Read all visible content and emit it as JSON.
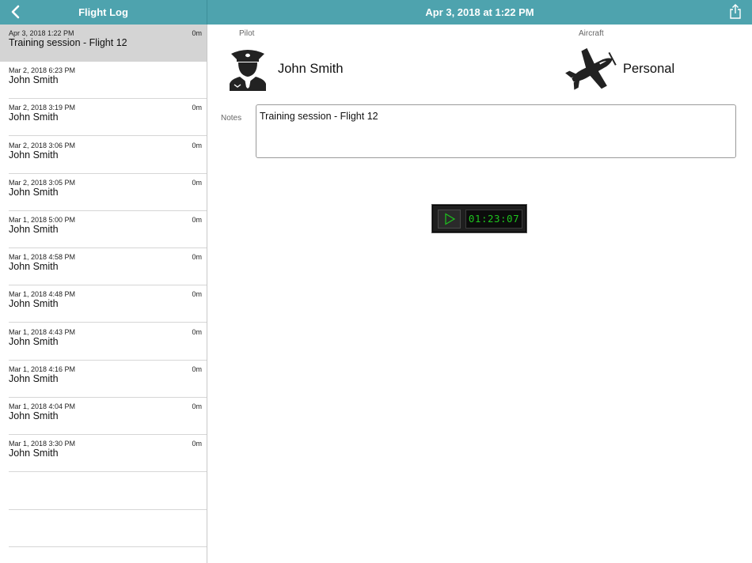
{
  "navbar": {
    "left_title": "Flight Log",
    "right_title": "Apr 3, 2018 at 1:22 PM",
    "back_icon": "chevron-left-icon",
    "share_icon": "share-icon"
  },
  "colors": {
    "navbar_bg": "#4ea3ae",
    "selected_row_bg": "#d4d4d4",
    "timer_digits": "#1ec31e"
  },
  "flights": [
    {
      "date": "Apr 3, 2018 1:22 PM",
      "duration": "0m",
      "title": "Training session - Flight 12",
      "selected": true
    },
    {
      "date": "Mar 2, 2018 6:23 PM",
      "duration": "",
      "title": "John Smith"
    },
    {
      "date": "Mar 2, 2018 3:19 PM",
      "duration": "0m",
      "title": "John Smith"
    },
    {
      "date": "Mar 2, 2018 3:06 PM",
      "duration": "0m",
      "title": "John Smith"
    },
    {
      "date": "Mar 2, 2018 3:05 PM",
      "duration": "0m",
      "title": "John Smith"
    },
    {
      "date": "Mar 1, 2018 5:00 PM",
      "duration": "0m",
      "title": "John Smith"
    },
    {
      "date": "Mar 1, 2018 4:58 PM",
      "duration": "0m",
      "title": "John Smith"
    },
    {
      "date": "Mar 1, 2018 4:48 PM",
      "duration": "0m",
      "title": "John Smith"
    },
    {
      "date": "Mar 1, 2018 4:43 PM",
      "duration": "0m",
      "title": "John Smith"
    },
    {
      "date": "Mar 1, 2018 4:16 PM",
      "duration": "0m",
      "title": "John Smith"
    },
    {
      "date": "Mar 1, 2018 4:04 PM",
      "duration": "0m",
      "title": "John Smith"
    },
    {
      "date": "Mar 1, 2018 3:30 PM",
      "duration": "0m",
      "title": "John Smith"
    }
  ],
  "detail": {
    "pilot_label": "Pilot",
    "pilot_name": "John Smith",
    "pilot_icon": "pilot-icon",
    "aircraft_label": "Aircraft",
    "aircraft_name": "Personal",
    "aircraft_icon": "airplane-icon",
    "notes_label": "Notes",
    "notes_value": "Training session - Flight 12"
  },
  "timer": {
    "play_icon": "play-icon",
    "elapsed": "01:23:07"
  }
}
